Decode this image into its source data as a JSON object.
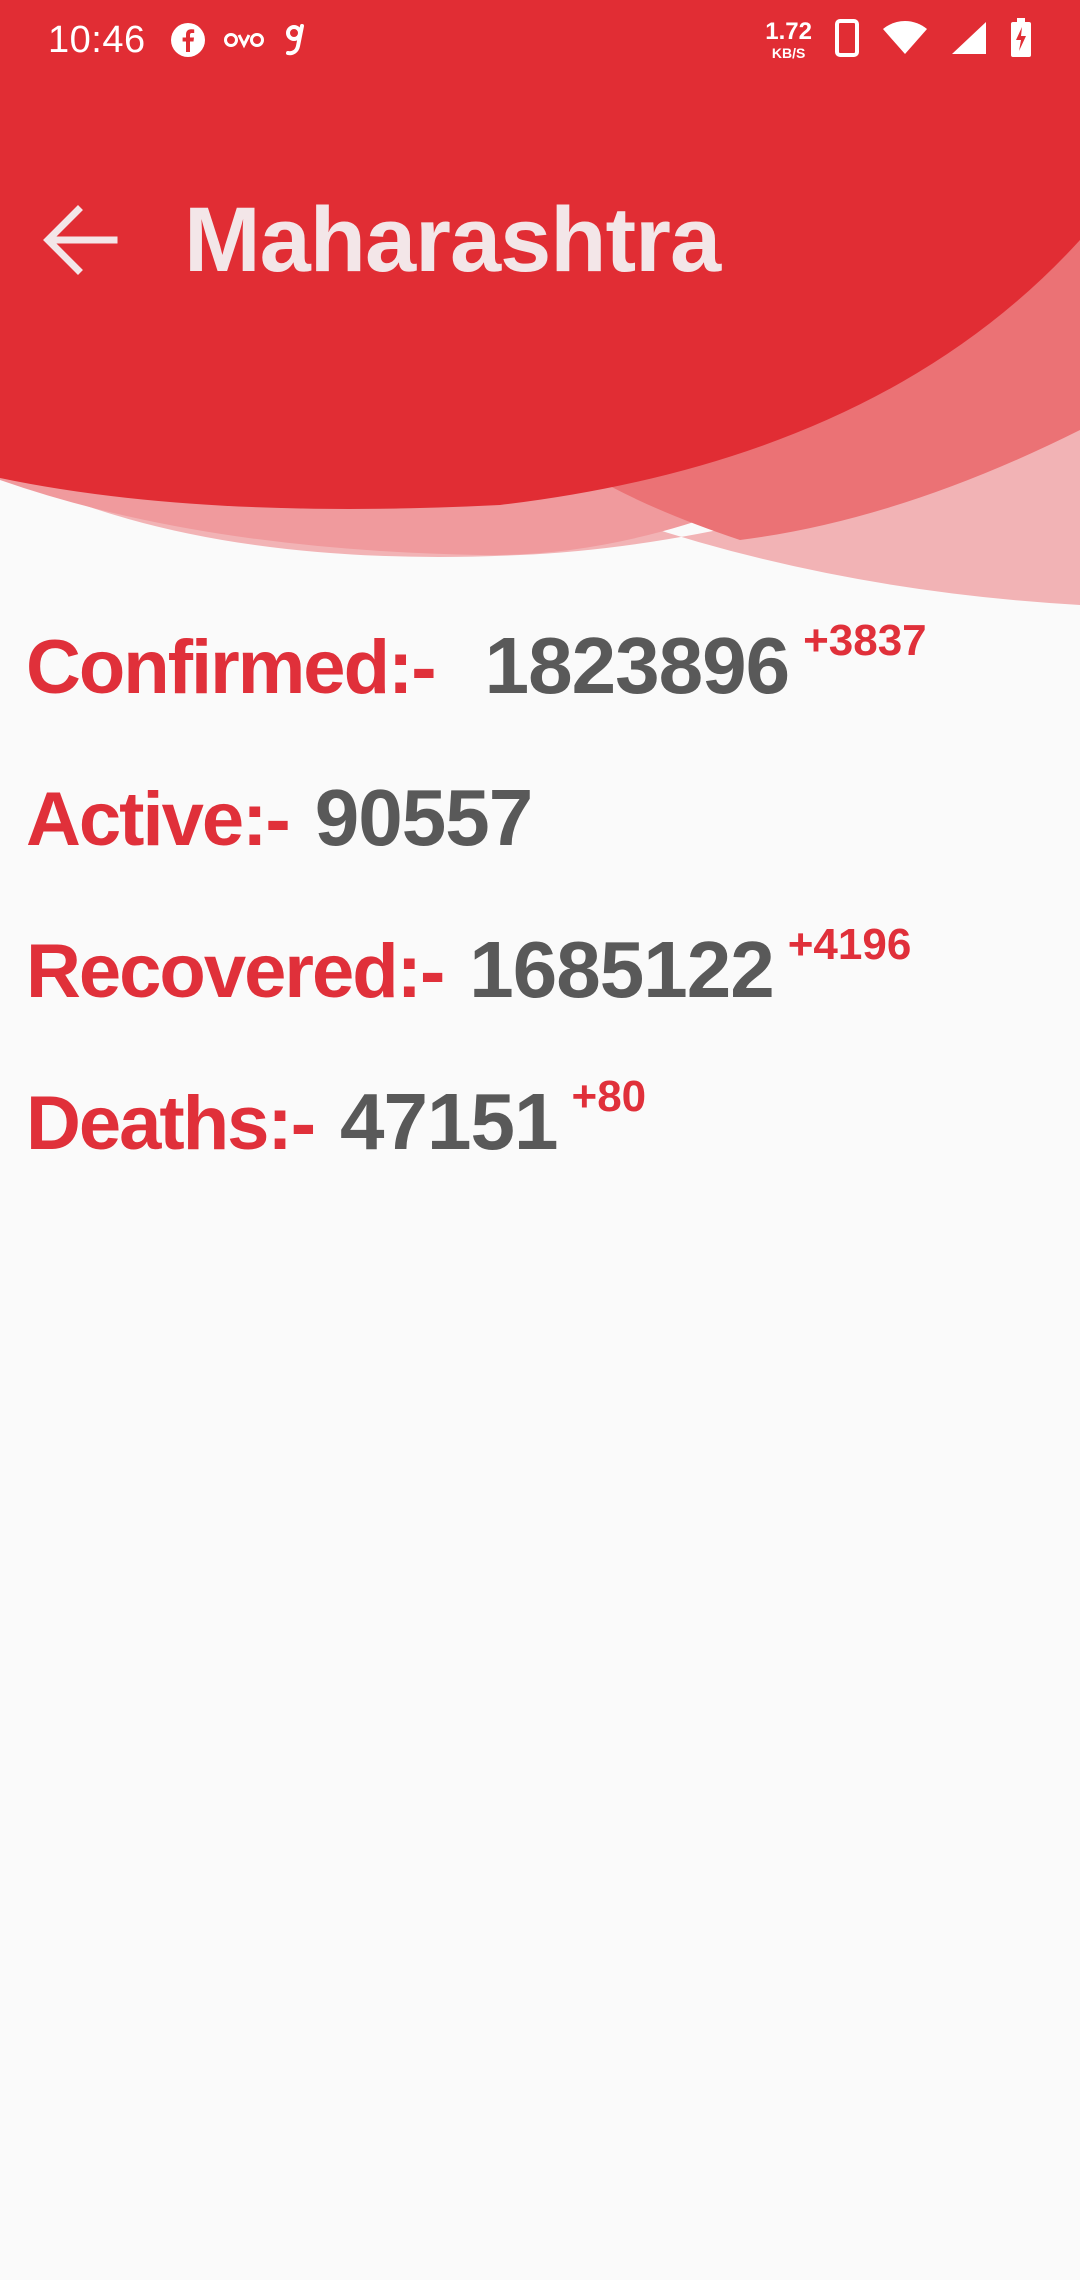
{
  "status_bar": {
    "time": "10:46",
    "app_icons": [
      "facebook-icon",
      "oyo-icon",
      "gaana-icon"
    ],
    "oyo_text": "OYO",
    "gaana_text": "g",
    "net_speed_value": "1.72",
    "net_speed_unit": "KB/S",
    "right_icons": [
      "phone-vibrate-icon",
      "wifi-icon",
      "cell-signal-icon",
      "battery-charging-icon"
    ]
  },
  "header": {
    "title": "Maharashtra",
    "back_icon": "arrow-back-icon"
  },
  "stats": [
    {
      "id": "confirmed",
      "label": "Confirmed:-",
      "value": "1823896",
      "delta": "+3837"
    },
    {
      "id": "active",
      "label": "Active:-",
      "value": "90557",
      "delta": ""
    },
    {
      "id": "recovered",
      "label": "Recovered:-",
      "value": "1685122",
      "delta": "+4196"
    },
    {
      "id": "deaths",
      "label": "Deaths:-",
      "value": "47151",
      "delta": "+80"
    }
  ],
  "colors": {
    "primary": "#e12d34",
    "wave_mid": "#eb7275",
    "wave_light": "#f2b3b5",
    "label": "#e0303a",
    "value": "#595959",
    "background": "#fafafa"
  }
}
